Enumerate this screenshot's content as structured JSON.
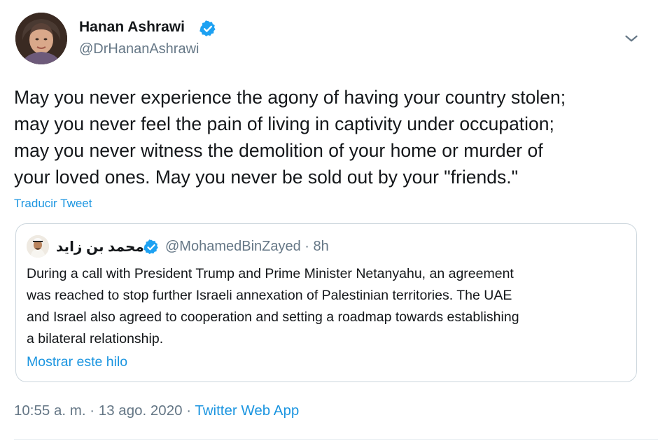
{
  "author": {
    "name": "Hanan Ashrawi",
    "handle": "@DrHananAshrawi",
    "verified": true
  },
  "icons": {
    "verified": "verified-badge-icon",
    "menu": "chevron-down-icon"
  },
  "tweet": {
    "lines": [
      "May you never experience the agony of having your country stolen;",
      "may you never feel the pain of living in captivity under occupation;",
      "may you never witness the demolition of your home or murder of",
      "your loved ones. May you never be sold out by your \"friends.\""
    ],
    "translate_label": "Traducir Tweet"
  },
  "quoted": {
    "name": "محمد بن زايد",
    "handle": "@MohamedBinZayed",
    "separator": "·",
    "time": "8h",
    "lines": [
      "During a call with President Trump and Prime Minister Netanyahu, an agreement",
      "was reached to stop further Israeli annexation of Palestinian territories. The UAE",
      "and Israel also agreed to cooperation and setting a roadmap towards establishing",
      "a bilateral relationship."
    ],
    "show_thread_label": "Mostrar este hilo"
  },
  "meta": {
    "time": "10:55 a. m.",
    "separator": "·",
    "date": "13 ago. 2020",
    "source": "Twitter Web App"
  },
  "colors": {
    "link": "#1b95e0",
    "muted": "#657786",
    "verified": "#1da1f2",
    "border": "#ccd6dd"
  }
}
